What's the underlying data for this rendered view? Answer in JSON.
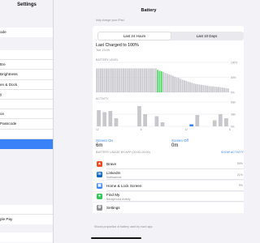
{
  "sidebar": {
    "title": "Settings",
    "items": [
      "ode",
      "",
      "",
      "ttre",
      "Brightness",
      "en & Dock",
      "y",
      "",
      "on",
      "Passcode",
      "",
      "",
      "ple Pay",
      "",
      ""
    ],
    "selected_index": 10
  },
  "header": {
    "title": "Battery",
    "hint": "fully charge your iPad."
  },
  "tabs": [
    {
      "label": "Last 24 Hours",
      "active": true
    },
    {
      "label": "Last 10 Days",
      "active": false
    }
  ],
  "last_charged": {
    "title": "Last Charged to 100%",
    "time": "Tue 23:09"
  },
  "battery_chart": {
    "label": "BATTERY LEVEL",
    "y_ticks": [
      "100%",
      "50%",
      "0%"
    ],
    "accent": "#4cd964",
    "bar_color": "#c7c7cc"
  },
  "activity_chart": {
    "label": "ACTIVITY",
    "y_ticks": [
      "60m",
      "30m",
      "0m"
    ],
    "x_ticks": [
      "12",
      "",
      "6",
      "",
      "12",
      "",
      "6"
    ],
    "bar_color": "#c7c7cc",
    "accent": "#3a82f7"
  },
  "chart_data": [
    {
      "type": "bar",
      "title": "BATTERY LEVEL",
      "ylim": [
        0,
        100
      ],
      "values": [
        80,
        80,
        80,
        80,
        80,
        80,
        80,
        80,
        80,
        80,
        80,
        80,
        80,
        80,
        80,
        80,
        80,
        80,
        80,
        80,
        80,
        80,
        80,
        80,
        80,
        80,
        80,
        80,
        80,
        80,
        80,
        80,
        75,
        72,
        70,
        68,
        65,
        62,
        60,
        58,
        55,
        52,
        50,
        48,
        45,
        42,
        40,
        38,
        36,
        34,
        32,
        30,
        28,
        27,
        26,
        25,
        24,
        23,
        22,
        21,
        20,
        20,
        19,
        18,
        18,
        17,
        16,
        15,
        14,
        13
      ],
      "highlight": [
        32,
        33,
        34
      ]
    },
    {
      "type": "bar",
      "title": "ACTIVITY",
      "ylim": [
        0,
        60
      ],
      "values": [
        40,
        35,
        38,
        20,
        0,
        0,
        0,
        50,
        30,
        0,
        25,
        10,
        0,
        0,
        0,
        0,
        5,
        28,
        0,
        0,
        15,
        30,
        20
      ],
      "highlight": [
        16
      ]
    }
  ],
  "screen_on": {
    "label": "Screen On",
    "value": "6m"
  },
  "screen_off": {
    "label": "Screen Off",
    "value": "0m"
  },
  "usage": {
    "header": "BATTERY USAGE BY APP (00:00–00:00)",
    "show_activity": "SHOW ACTIVITY",
    "apps": [
      {
        "name": "Brave",
        "sub": "",
        "pct": "59%",
        "icon": "brave-icon",
        "color": "#f04b23",
        "glyph": "▲"
      },
      {
        "name": "LinkedIn",
        "sub": "Notifications",
        "pct": "21%",
        "icon": "linkedin-icon",
        "color": "#0a66c2",
        "glyph": "in"
      },
      {
        "name": "Home & Lock Screen",
        "sub": "",
        "pct": "9%",
        "icon": "home-lock-icon",
        "color": "#3a82f7",
        "glyph": "▣"
      },
      {
        "name": "Find My",
        "sub": "Background Activity",
        "pct": "",
        "icon": "find-my-icon",
        "color": "#34c759",
        "glyph": "●"
      },
      {
        "name": "Settings",
        "sub": "",
        "pct": "",
        "icon": "settings-icon",
        "color": "#8e8e93",
        "glyph": "⚙"
      }
    ]
  },
  "footer": "Shows proportion of battery used by each app."
}
